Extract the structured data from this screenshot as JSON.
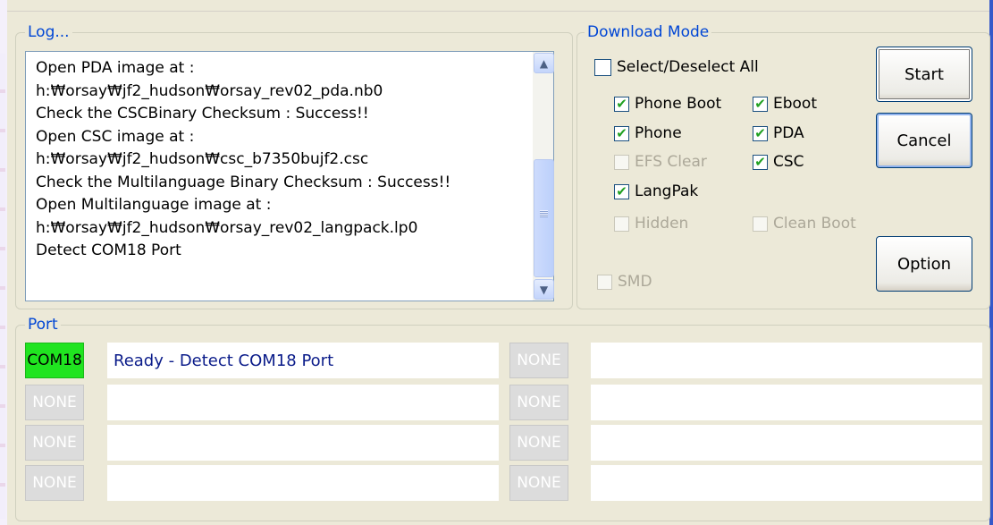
{
  "log": {
    "title": "Log...",
    "lines": [
      "Open PDA image at :",
      "h:₩orsay₩jf2_hudson₩orsay_rev02_pda.nb0",
      "Check the CSCBinary Checksum : Success!!",
      "Open CSC image at :",
      "h:₩orsay₩jf2_hudson₩csc_b7350bujf2.csc",
      "Check the Multilanguage Binary Checksum : Success!!",
      "Open Multilanguage  image at :",
      "h:₩orsay₩jf2_hudson₩orsay_rev02_langpack.lp0",
      "Detect COM18 Port"
    ]
  },
  "download": {
    "title": "Download Mode",
    "select_all": "Select/Deselect All",
    "options": {
      "phone_boot": {
        "label": "Phone Boot",
        "checked": true
      },
      "eboot": {
        "label": "Eboot",
        "checked": true
      },
      "phone": {
        "label": "Phone",
        "checked": true
      },
      "pda": {
        "label": "PDA",
        "checked": true
      },
      "efs_clear": {
        "label": "EFS Clear",
        "checked": false,
        "disabled": true
      },
      "csc": {
        "label": "CSC",
        "checked": true
      },
      "langpak": {
        "label": "LangPak",
        "checked": true
      },
      "hidden": {
        "label": "Hidden",
        "checked": false,
        "disabled": true
      },
      "clean_boot": {
        "label": "Clean Boot",
        "checked": false,
        "disabled": true
      },
      "smd": {
        "label": "SMD",
        "checked": false,
        "disabled": true
      }
    },
    "check_glyph": "✔"
  },
  "buttons": {
    "start": "Start",
    "cancel": "Cancel",
    "option": "Option"
  },
  "port": {
    "title": "Port",
    "left": [
      {
        "name": "COM18",
        "status": "Ready - Detect COM18 Port"
      },
      {
        "name": "NONE",
        "status": ""
      },
      {
        "name": "NONE",
        "status": ""
      },
      {
        "name": "NONE",
        "status": ""
      }
    ],
    "right": [
      {
        "name": "NONE",
        "status": ""
      },
      {
        "name": "NONE",
        "status": ""
      },
      {
        "name": "NONE",
        "status": ""
      },
      {
        "name": "NONE",
        "status": ""
      }
    ]
  },
  "colors": {
    "active_port": "#20e420",
    "accent": "#0046d5",
    "window_bg": "#ece9d8"
  },
  "icons": {
    "scroll_up": "▲",
    "scroll_down": "▼"
  }
}
